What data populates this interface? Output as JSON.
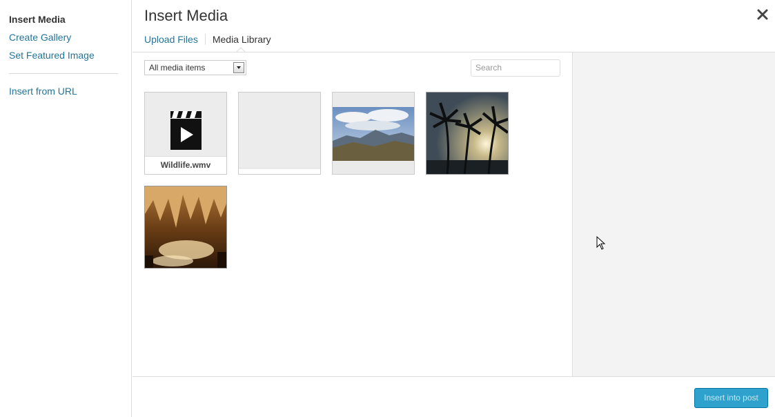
{
  "menu": {
    "items": [
      {
        "label": "Insert Media"
      },
      {
        "label": "Create Gallery"
      },
      {
        "label": "Set Featured Image"
      },
      {
        "label": "Insert from URL"
      }
    ]
  },
  "frame": {
    "title": "Insert Media",
    "router": [
      {
        "label": "Upload Files"
      },
      {
        "label": "Media Library"
      }
    ]
  },
  "toolbar_filter": {
    "select_value": "All media items",
    "search_placeholder": "Search"
  },
  "attachments": [
    {
      "caption": "Wildlife.wmv",
      "kind": "video-icon"
    },
    {
      "caption": "",
      "kind": "blank"
    },
    {
      "caption": "",
      "kind": "mountain-landscape"
    },
    {
      "caption": "",
      "kind": "palm-sunset"
    },
    {
      "caption": "",
      "kind": "cave-stalactites"
    }
  ],
  "footer": {
    "insert_label": "Insert into post"
  },
  "colors": {
    "link": "#21759b",
    "primary_button": "#2ea2cc"
  }
}
